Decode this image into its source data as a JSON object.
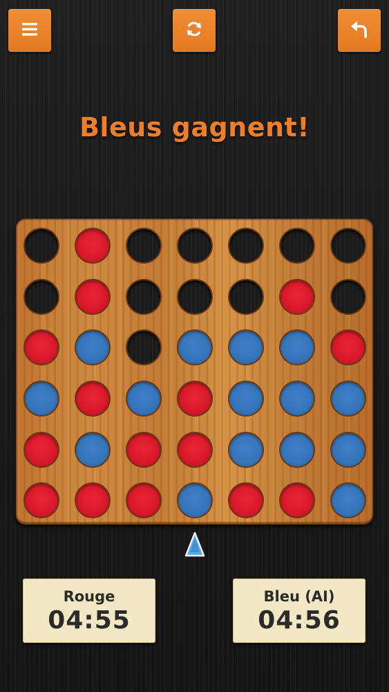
{
  "toolbar": {
    "menu_icon": "hamburger-menu-icon",
    "restart_icon": "refresh-icon",
    "undo_icon": "undo-arrow-icon",
    "button_color": "#ec8530"
  },
  "status": {
    "message": "Bleus gagnent!",
    "color": "#ee7e2a"
  },
  "board": {
    "rows": 6,
    "columns": 7,
    "colors": {
      "red": "#d6182a",
      "blue": "#3574b8",
      "board": "#c98236"
    },
    "cells": [
      [
        "empty",
        "red",
        "empty",
        "empty",
        "empty",
        "empty",
        "empty"
      ],
      [
        "empty",
        "red",
        "empty",
        "empty",
        "empty",
        "red",
        "empty"
      ],
      [
        "red",
        "blue",
        "empty",
        "blue",
        "blue",
        "blue",
        "red"
      ],
      [
        "blue",
        "red",
        "blue",
        "red",
        "blue",
        "blue",
        "blue"
      ],
      [
        "red",
        "blue",
        "red",
        "red",
        "blue",
        "blue",
        "blue"
      ],
      [
        "red",
        "red",
        "red",
        "blue",
        "red",
        "red",
        "blue"
      ]
    ],
    "marker_column": 3,
    "marker_icon": "triangle-up-icon"
  },
  "players": [
    {
      "name": "Rouge",
      "time": "04:55"
    },
    {
      "name": "Bleu (AI)",
      "time": "04:56"
    }
  ]
}
